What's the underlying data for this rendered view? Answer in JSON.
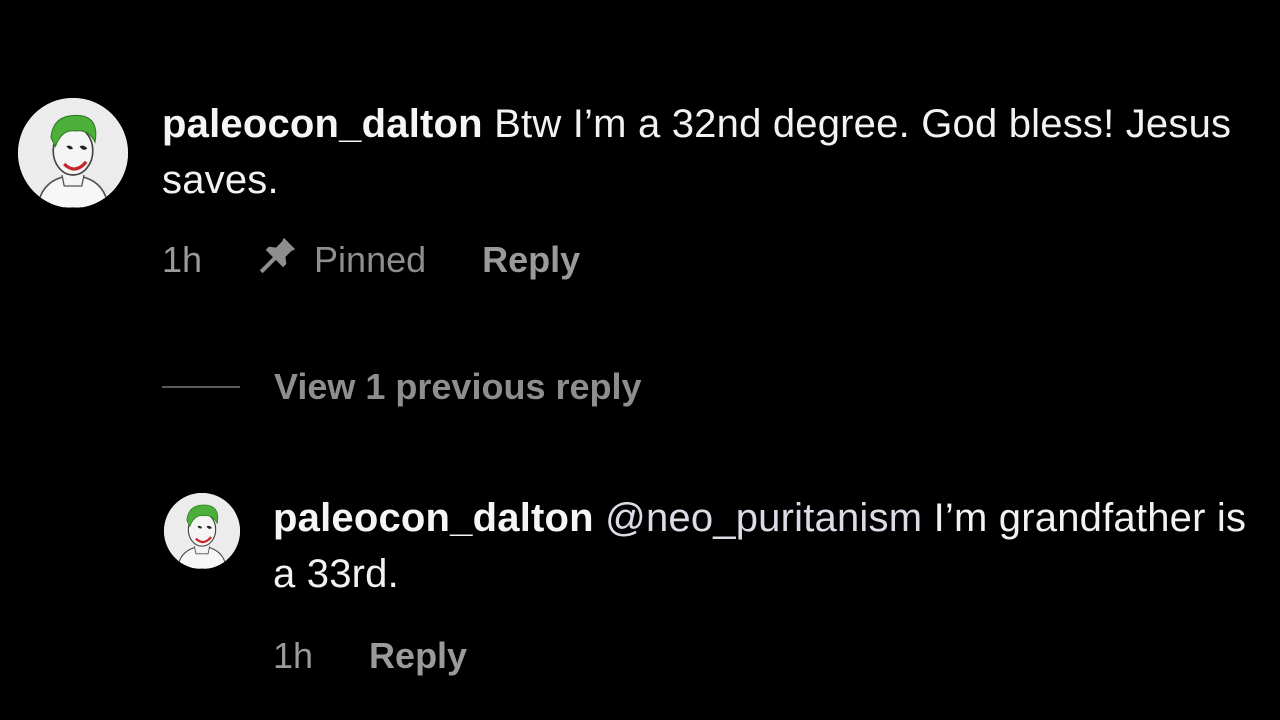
{
  "comment": {
    "username": "paleocon_dalton",
    "text": "Btw I’m a 32nd degree. God bless! Jesus saves.",
    "time": "1h",
    "pinned_label": "Pinned",
    "reply_label": "Reply",
    "pin_icon": "pin-icon"
  },
  "thread": {
    "view_replies_label": "View 1 previous reply"
  },
  "reply": {
    "username": "paleocon_dalton",
    "mention": "@neo_puritanism",
    "text": "I’m grandfather is a 33rd.",
    "time": "1h",
    "reply_label": "Reply"
  },
  "colors": {
    "background": "#000000",
    "primary_text": "#f2f2f2",
    "secondary_text": "#8e8e8e",
    "avatar_hair": "#4caf3a"
  }
}
